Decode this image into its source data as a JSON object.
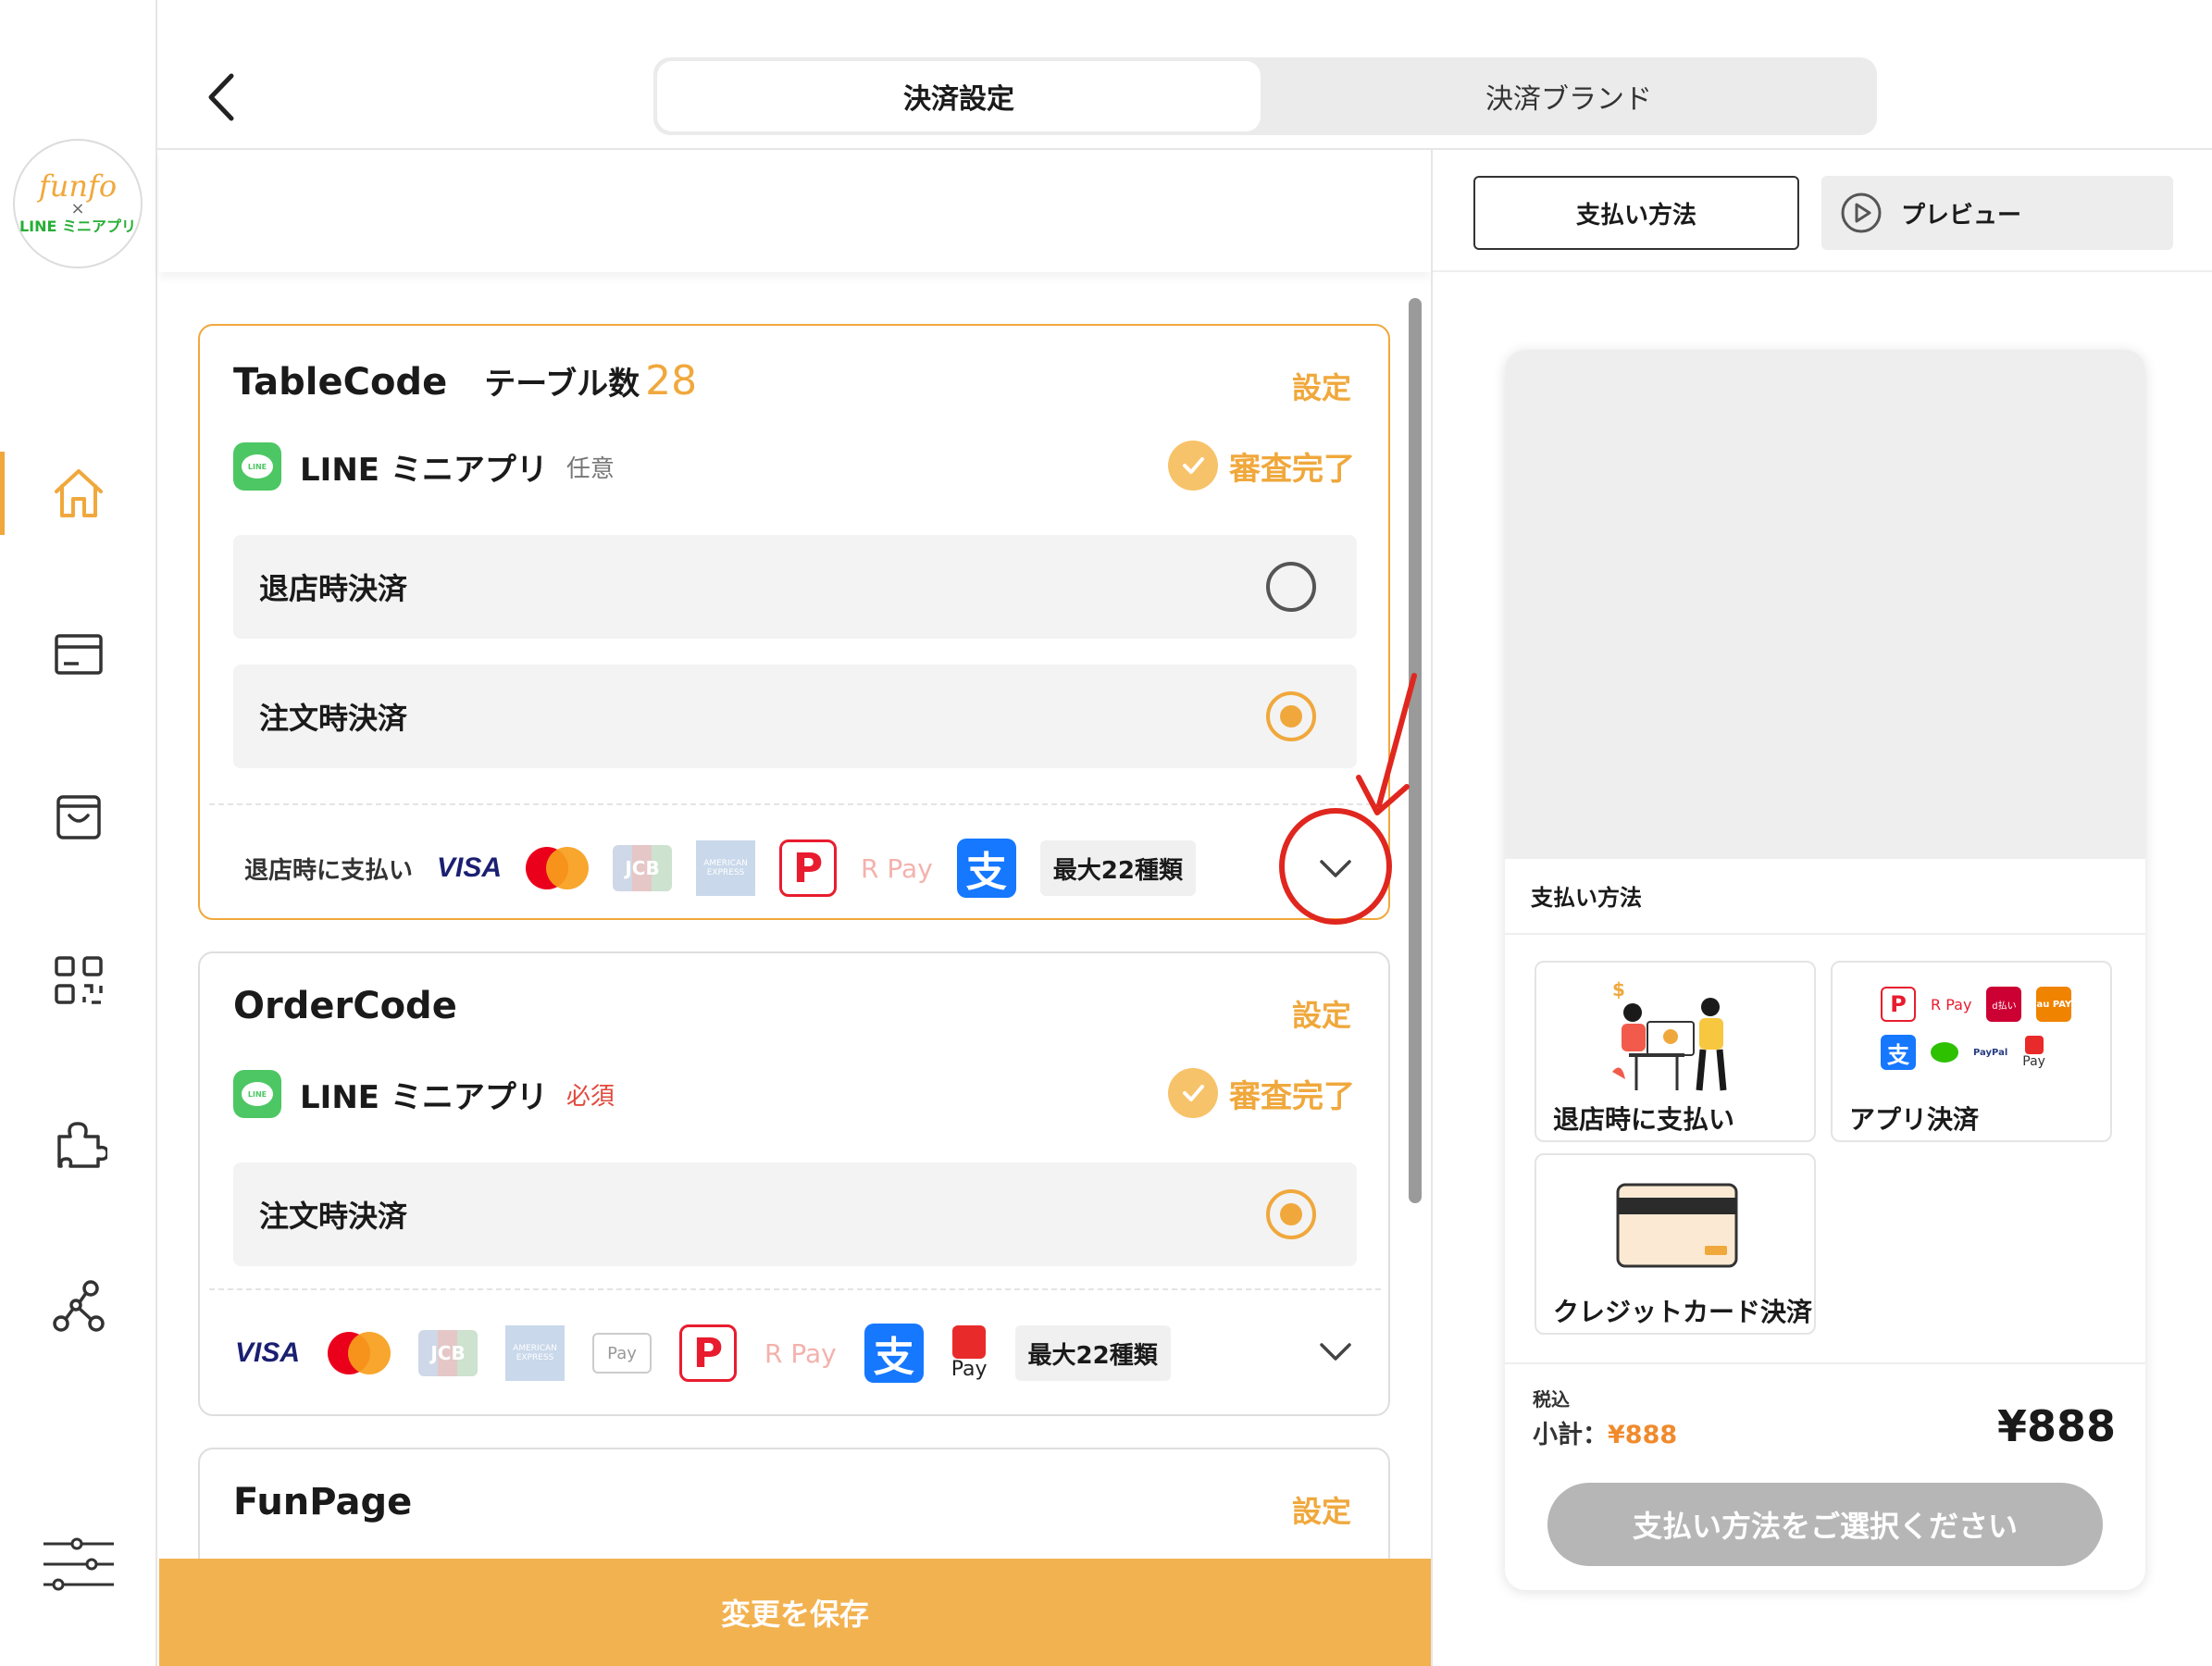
{
  "logo": {
    "line1": "funfo",
    "line2": "×",
    "line3": "LINE ミニアプリ"
  },
  "header": {
    "tabs": [
      {
        "label": "決済設定",
        "active": true
      },
      {
        "label": "決済ブランド",
        "active": false
      }
    ]
  },
  "preview_toolbar": {
    "methods_label": "支払い方法",
    "preview_label": "プレビュー"
  },
  "cards": {
    "tablecode": {
      "title": "TableCode",
      "subtitle": "テーブル数",
      "table_count": "28",
      "setting_label": "設定",
      "line_label": "LINE ミニアプリ",
      "line_icon_text": "LINE",
      "line_tag": "任意",
      "status": "審査完了",
      "options": [
        {
          "label": "退店時決済",
          "selected": false
        },
        {
          "label": "注文時決済",
          "selected": true
        }
      ],
      "brands_label": "退店時に支払い",
      "brands": {
        "visa": "VISA",
        "jcb": "JCB",
        "amex": "AMERICAN EXPRESS",
        "paypay": "P",
        "rpay": "R Pay",
        "alipay": "支"
      },
      "max_label": "最大22種類"
    },
    "ordercode": {
      "title": "OrderCode",
      "setting_label": "設定",
      "line_label": "LINE ミニアプリ",
      "line_icon_text": "LINE",
      "line_tag": "必須",
      "status": "審査完了",
      "options": [
        {
          "label": "注文時決済",
          "selected": true
        }
      ],
      "brands": {
        "visa": "VISA",
        "jcb": "JCB",
        "amex": "AMERICAN EXPRESS",
        "applepay": "Pay",
        "paypay": "P",
        "rpay": "R Pay",
        "alipay": "支",
        "merpay": "Pay"
      },
      "max_label": "最大22種類"
    },
    "funpage": {
      "title": "FunPage",
      "setting_label": "設定"
    }
  },
  "save_label": "変更を保存",
  "preview": {
    "section_title": "支払い方法",
    "methods": [
      {
        "label": "退店時に支払い"
      },
      {
        "label": "アプリ決済",
        "mini_brands": [
          "P",
          "R Pay",
          "d払い",
          "au PAY",
          "支",
          "PayPal",
          "Pay"
        ]
      },
      {
        "label": "クレジットカード決済"
      }
    ],
    "tax_label": "税込",
    "subtotal_label": "小計：",
    "subtotal_value": "¥888",
    "total": "¥888",
    "pay_button": "支払い方法をご選択ください"
  },
  "colors": {
    "accent": "#f0a83c",
    "line_green": "#4cc764",
    "required_red": "#e2483c",
    "annotation_red": "#e0271f"
  },
  "icons": [
    "back-chevron-icon",
    "home-icon",
    "card-icon",
    "bag-icon",
    "qr-icon",
    "puzzle-icon",
    "network-icon",
    "sliders-icon",
    "play-icon",
    "check-icon",
    "chevron-down-icon"
  ]
}
